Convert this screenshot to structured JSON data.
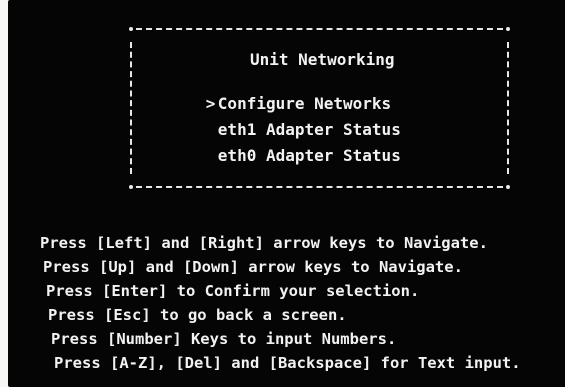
{
  "menu": {
    "title": "Unit Networking",
    "cursor": ">",
    "items": [
      {
        "label": "Configure Networks",
        "selected": true
      },
      {
        "label": "eth1 Adapter Status",
        "selected": false
      },
      {
        "label": "eth0 Adapter Status",
        "selected": false
      }
    ]
  },
  "help": [
    "Press [Left] and [Right] arrow keys to Navigate.",
    "Press [Up] and [Down] arrow keys to Navigate.",
    "Press [Enter] to Confirm your selection.",
    "Press [Esc] to go back a screen.",
    "Press [Number] Keys to input Numbers.",
    "Press [A-Z], [Del] and [Backspace] for Text input."
  ],
  "colors": {
    "background": "#050505",
    "text": "#f2f2f2"
  }
}
